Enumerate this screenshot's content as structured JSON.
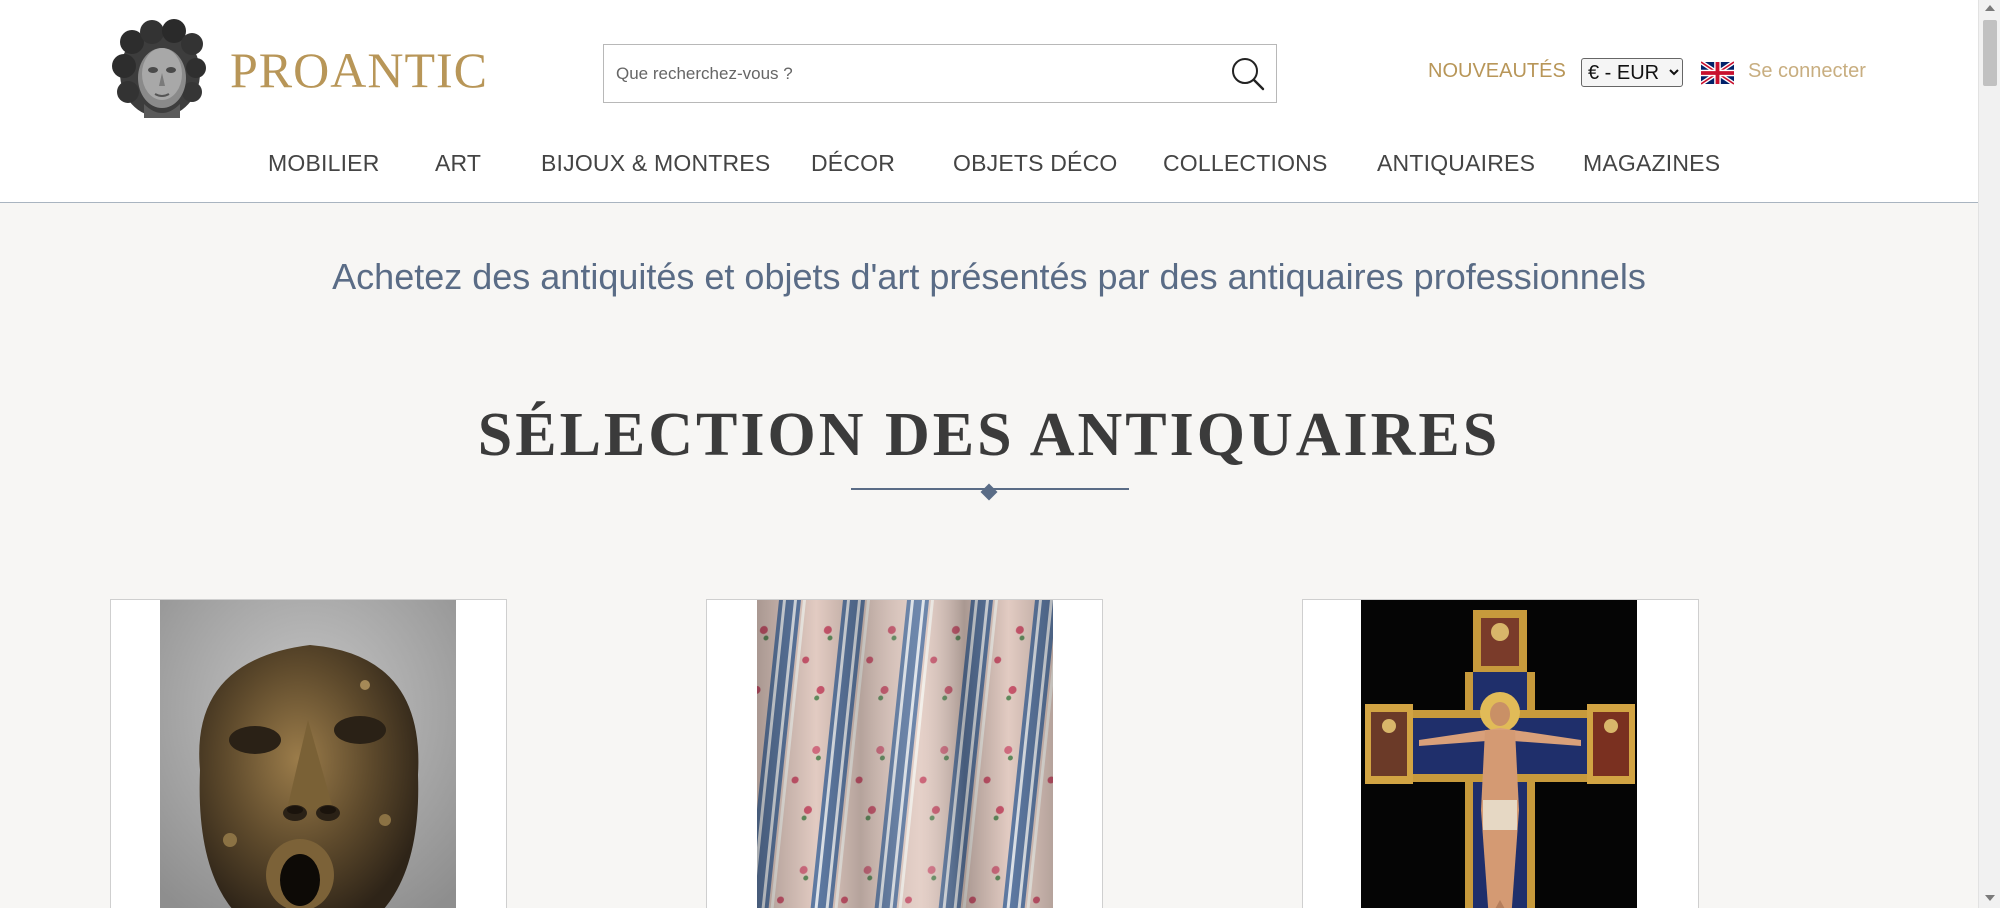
{
  "brand": {
    "name": "PROANTIC",
    "logo_icon": "antique-bust-icon",
    "accent_color": "#b89658"
  },
  "search": {
    "placeholder": "Que recherchez-vous ?",
    "icon": "search-icon"
  },
  "header_links": {
    "nouveautes": "NOUVEAUTÉS",
    "currency_selected": "€ - EUR",
    "language_flag": "uk-flag-icon",
    "login": "Se connecter"
  },
  "nav": {
    "items": [
      {
        "label": "MOBILIER"
      },
      {
        "label": "ART"
      },
      {
        "label": "BIJOUX & MONTRES"
      },
      {
        "label": "DÉCOR"
      },
      {
        "label": "OBJETS DÉCO"
      },
      {
        "label": "COLLECTIONS"
      },
      {
        "label": "ANTIQUAIRES"
      },
      {
        "label": "MAGAZINES"
      }
    ]
  },
  "main": {
    "tagline": "Achetez des antiquités et objets d'art présentés par des antiquaires professionnels",
    "section_title": "SÉLECTION DES ANTIQUAIRES",
    "title_color": "#5a6c86"
  },
  "cards": [
    {
      "image": "bronze-mask-image"
    },
    {
      "image": "striped-floral-fabric-image"
    },
    {
      "image": "painted-crucifix-image"
    }
  ]
}
